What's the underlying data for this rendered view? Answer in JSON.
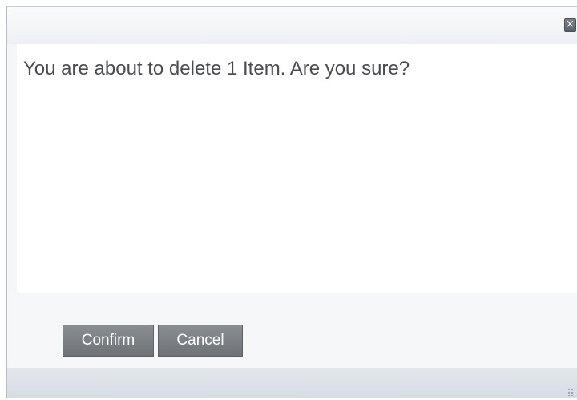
{
  "dialog": {
    "close_glyph": "×",
    "close_icon": "close-icon",
    "message": "You are about to delete 1 Item. Are you sure?",
    "buttons": {
      "confirm_label": "Confirm",
      "cancel_label": "Cancel"
    },
    "resize_icon": "resize-grip-icon"
  },
  "colors": {
    "button_bg": "#7a7e83",
    "button_text": "#ffffff",
    "message_text": "#4a4c50",
    "titlebar_bg": "#f4f6f8",
    "footer_bar_bg": "#dde2e8"
  }
}
